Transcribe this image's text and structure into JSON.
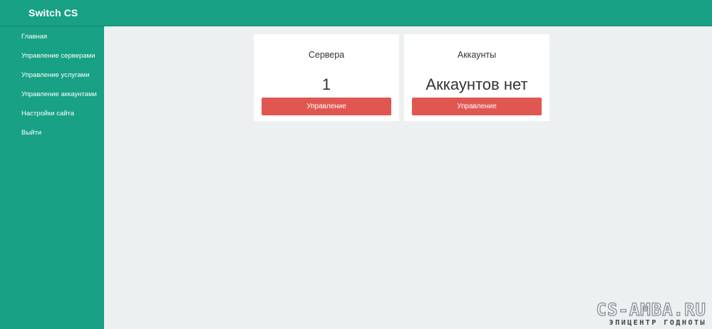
{
  "app": {
    "brand": "Switch CS"
  },
  "sidebar": {
    "items": [
      {
        "label": "Главная"
      },
      {
        "label": "Управление серверами"
      },
      {
        "label": "Управление услугами"
      },
      {
        "label": "Управление аккаунтами"
      },
      {
        "label": "Настройки сайта"
      },
      {
        "label": "Выйти"
      }
    ]
  },
  "cards": [
    {
      "title": "Сервера",
      "value": "1",
      "button_label": "Управление"
    },
    {
      "title": "Аккаунты",
      "value": "Аккаунтов нет",
      "button_label": "Управление"
    }
  ],
  "watermark": {
    "logo": "CS-AMBA.RU",
    "tagline": "ЭПИЦЕНТР ГОДНОТЫ"
  },
  "colors": {
    "primary": "#18a184",
    "content_bg": "#edf0f1",
    "card_bg": "#ffffff",
    "button": "#e05752"
  }
}
